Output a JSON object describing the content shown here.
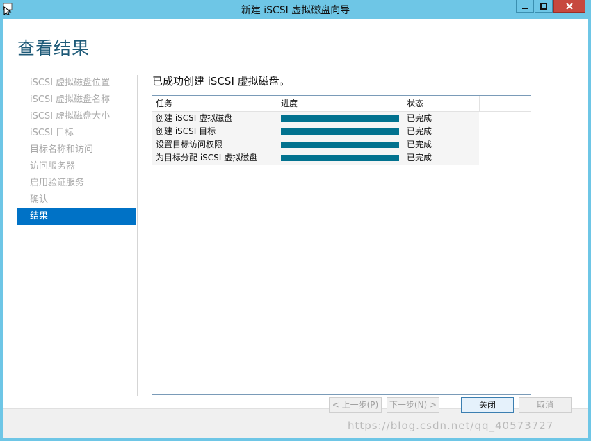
{
  "window": {
    "title": "新建 iSCSI 虚拟磁盘向导"
  },
  "page": {
    "title": "查看结果",
    "result_message": "已成功创建 iSCSI 虚拟磁盘。"
  },
  "steps": [
    {
      "label": "iSCSI 虚拟磁盘位置",
      "active": false
    },
    {
      "label": "iSCSI 虚拟磁盘名称",
      "active": false
    },
    {
      "label": "iSCSI 虚拟磁盘大小",
      "active": false
    },
    {
      "label": "iSCSI 目标",
      "active": false
    },
    {
      "label": "目标名称和访问",
      "active": false
    },
    {
      "label": "访问服务器",
      "active": false
    },
    {
      "label": "启用验证服务",
      "active": false
    },
    {
      "label": "确认",
      "active": false
    },
    {
      "label": "结果",
      "active": true
    }
  ],
  "table": {
    "columns": [
      "任务",
      "进度",
      "状态"
    ],
    "rows": [
      {
        "task": "创建 iSCSI 虚拟磁盘",
        "progress": 1.0,
        "status": "已完成"
      },
      {
        "task": "创建 iSCSI 目标",
        "progress": 1.0,
        "status": "已完成"
      },
      {
        "task": "设置目标访问权限",
        "progress": 1.0,
        "status": "已完成"
      },
      {
        "task": "为目标分配 iSCSI 虚拟磁盘",
        "progress": 1.0,
        "status": "已完成"
      }
    ]
  },
  "buttons": {
    "previous": "< 上一步(P)",
    "next": "下一步(N) >",
    "close": "关闭",
    "cancel": "取消"
  },
  "watermark": "https://blog.csdn.net/qq_40573727",
  "colors": {
    "titlebar": "#6ec6e6",
    "accent": "#0072c6",
    "progress": "#02728f",
    "title_text": "#1e5a78"
  }
}
